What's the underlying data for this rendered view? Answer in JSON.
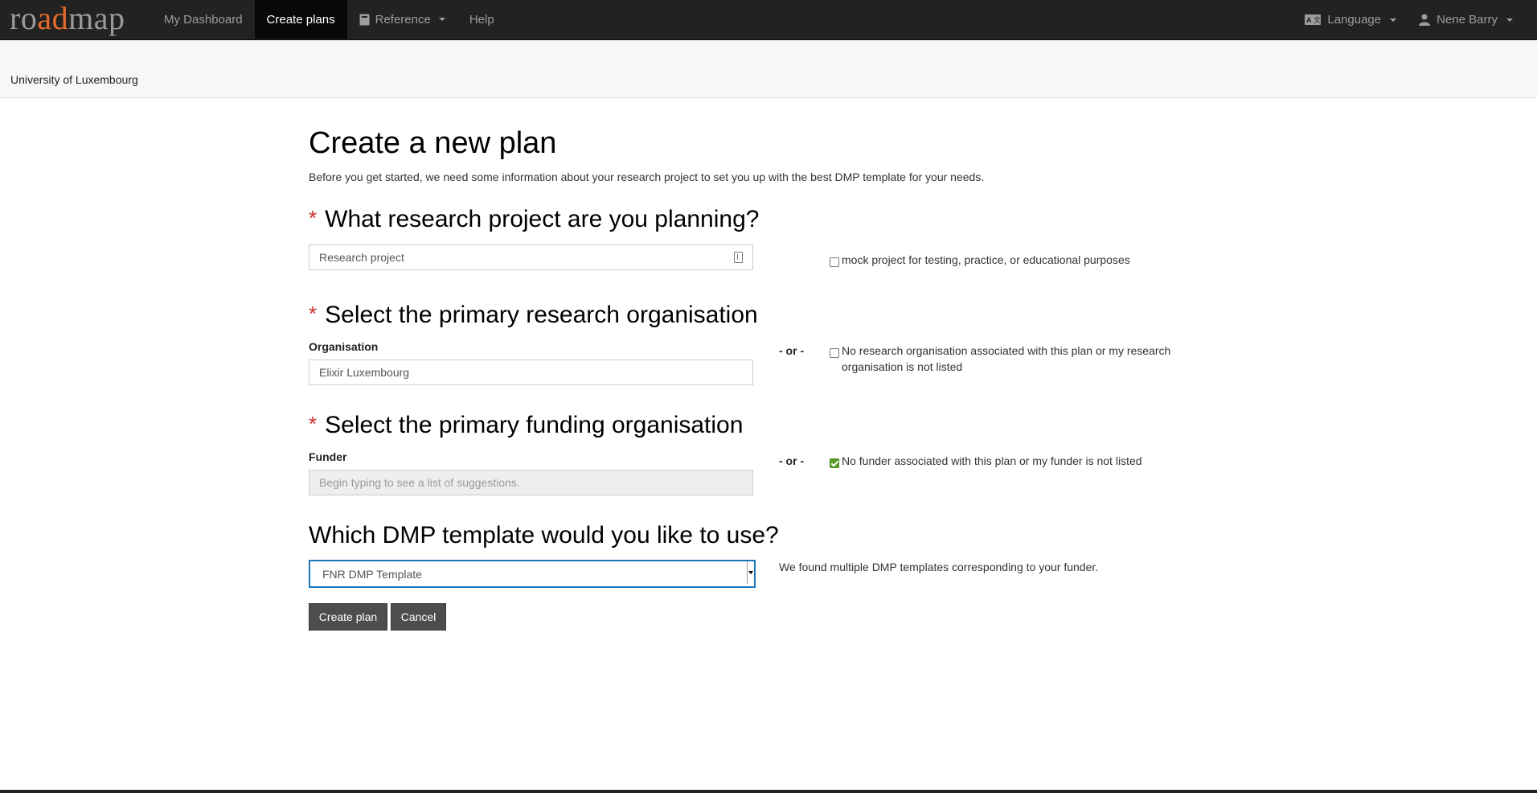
{
  "header": {
    "logo": {
      "part1": "ro",
      "part2": "ad",
      "part3": "map"
    },
    "nav": [
      {
        "label": "My Dashboard"
      },
      {
        "label": "Create plans"
      },
      {
        "label": "Reference"
      },
      {
        "label": "Help"
      }
    ],
    "language_label": "Language",
    "user_label": "Nene Barry"
  },
  "subheader": {
    "organisation": "University of Luxembourg"
  },
  "form": {
    "title": "Create a new plan",
    "intro": "Before you get started, we need some information about your research project to set you up with the best DMP template for your needs.",
    "required_marker": "*",
    "project": {
      "heading": "What research project are you planning?",
      "value": "Research project",
      "mock_label": "mock project for testing, practice, or educational purposes",
      "mock_checked": false
    },
    "research_org": {
      "heading": "Select the primary research organisation",
      "field_label": "Organisation",
      "value": "Elixir Luxembourg",
      "or": "- or -",
      "none_label": "No research organisation associated with this plan or my research organisation is not listed",
      "none_checked": false
    },
    "funder": {
      "heading": "Select the primary funding organisation",
      "field_label": "Funder",
      "placeholder": "Begin typing to see a list of suggestions.",
      "or": "- or -",
      "none_label": "No funder associated with this plan or my funder is not listed",
      "none_checked": true
    },
    "template": {
      "heading": "Which DMP template would you like to use?",
      "selected": "FNR DMP Template",
      "note": "We found multiple DMP templates corresponding to your funder."
    },
    "buttons": {
      "create": "Create plan",
      "cancel": "Cancel"
    }
  },
  "colors": {
    "navbar": "#222222",
    "accent_orange": "#e46a2b",
    "required_red": "#c9302c",
    "checked_green": "#5a9c29",
    "button": "#4d4d4d"
  }
}
